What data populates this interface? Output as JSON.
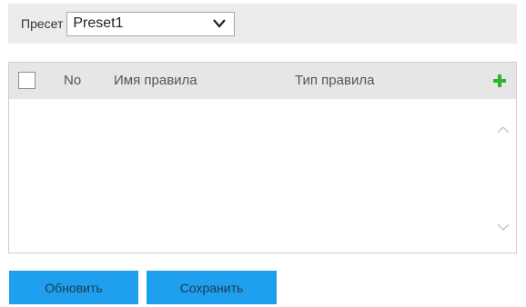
{
  "preset": {
    "label": "Пресет",
    "selected_value": "Preset1"
  },
  "table": {
    "columns": {
      "no": "No",
      "name": "Имя правила",
      "type": "Тип правила"
    },
    "rows": []
  },
  "buttons": {
    "refresh": "Обновить",
    "save": "Сохранить"
  },
  "colors": {
    "accent_button": "#1ea0ef",
    "add_icon": "#2db52d",
    "header_background": "#e6e6e6",
    "preset_bar_background": "#ececec"
  },
  "icons": {
    "dropdown": "chevron-down-icon",
    "add": "plus-icon",
    "scroll_up": "chevron-up-icon",
    "scroll_down": "chevron-down-icon"
  }
}
